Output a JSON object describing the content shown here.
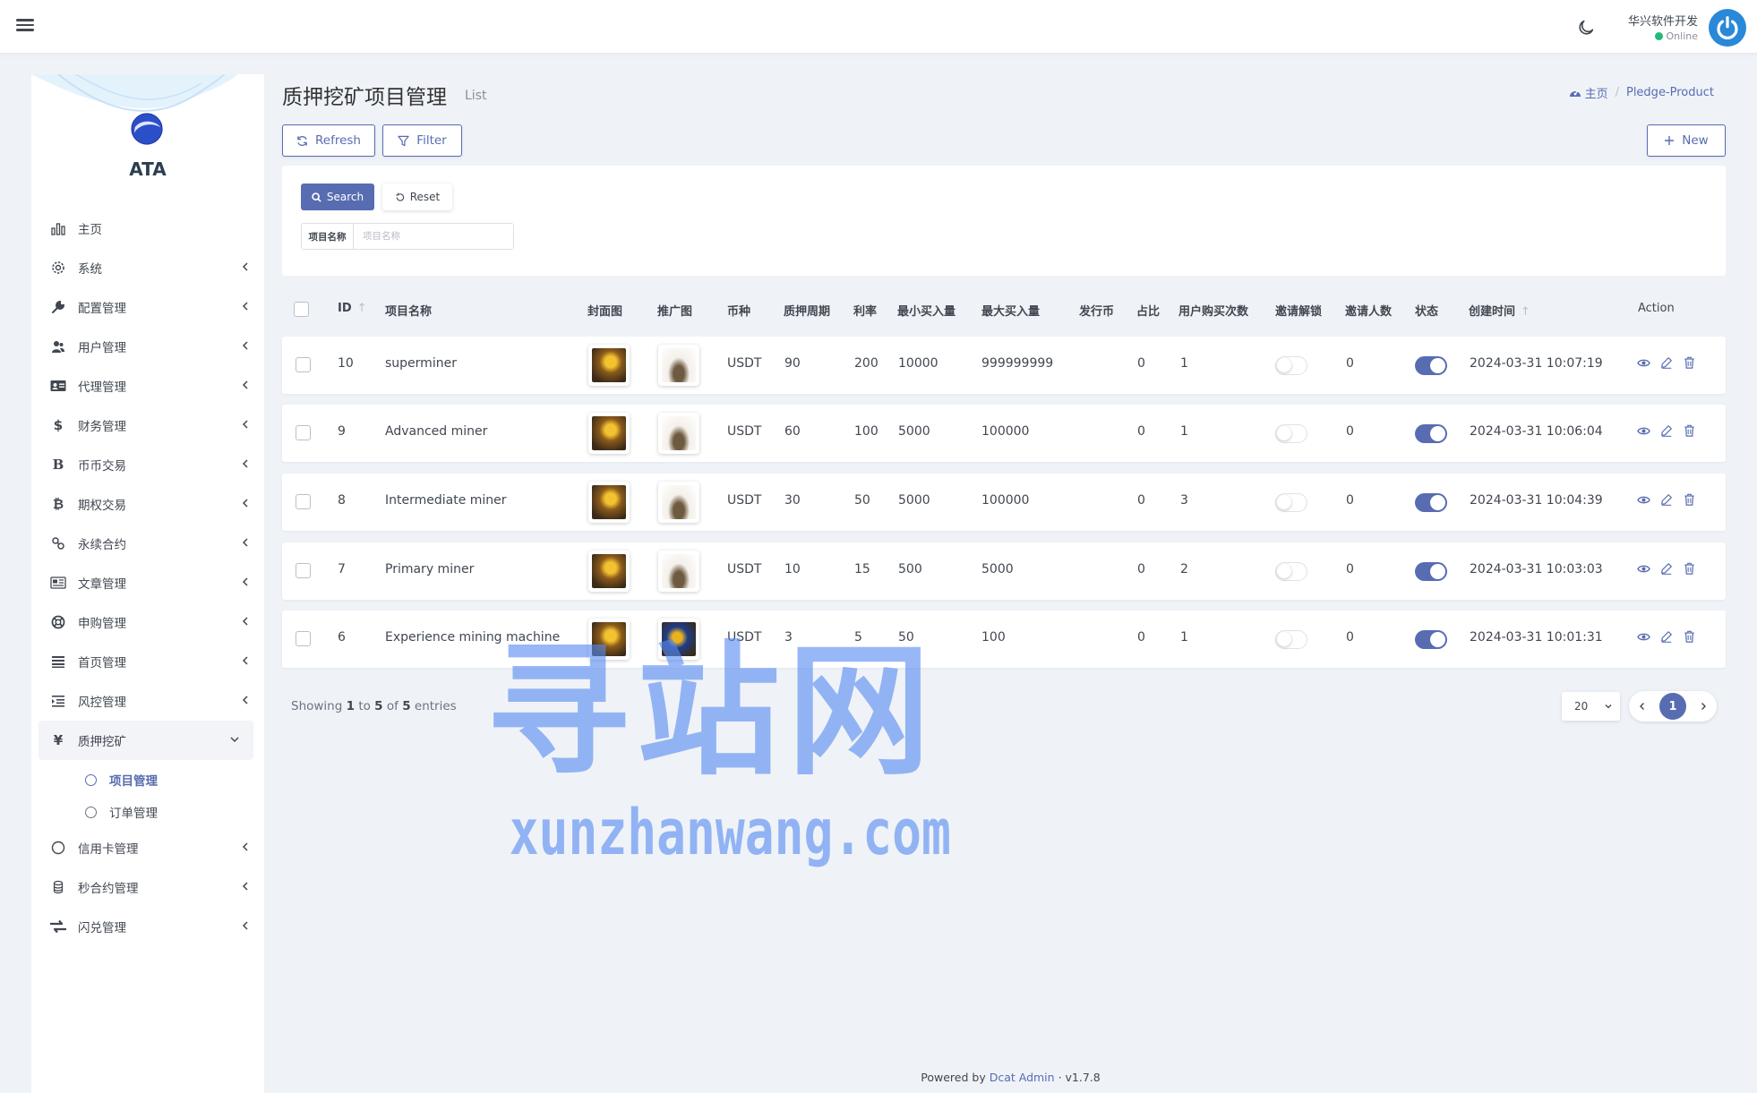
{
  "header": {
    "user_name": "华兴软件开发",
    "user_status": "Online"
  },
  "sidebar": {
    "brand": "ATA",
    "items": [
      {
        "label": "主页",
        "icon": "bar-chart-icon",
        "has_children": false
      },
      {
        "label": "系统",
        "icon": "gear-icon",
        "has_children": true
      },
      {
        "label": "配置管理",
        "icon": "wrench-icon",
        "has_children": true
      },
      {
        "label": "用户管理",
        "icon": "users-icon",
        "has_children": true
      },
      {
        "label": "代理管理",
        "icon": "id-card-icon",
        "has_children": true
      },
      {
        "label": "财务管理",
        "icon": "dollar-icon",
        "has_children": true
      },
      {
        "label": "币币交易",
        "icon": "bold-b-icon",
        "has_children": true
      },
      {
        "label": "期权交易",
        "icon": "bitcoin-icon",
        "has_children": true
      },
      {
        "label": "永续合约",
        "icon": "link-icon",
        "has_children": true
      },
      {
        "label": "文章管理",
        "icon": "newspaper-icon",
        "has_children": true
      },
      {
        "label": "申购管理",
        "icon": "lifebuoy-icon",
        "has_children": true
      },
      {
        "label": "首页管理",
        "icon": "list-icon",
        "has_children": true
      },
      {
        "label": "风控管理",
        "icon": "outdent-icon",
        "has_children": true
      },
      {
        "label": "质押挖矿",
        "icon": "yen-icon",
        "has_children": true,
        "expanded": true
      },
      {
        "label": "信用卡管理",
        "icon": "circle-icon",
        "has_children": true
      },
      {
        "label": "秒合约管理",
        "icon": "coins-icon",
        "has_children": true
      },
      {
        "label": "闪兑管理",
        "icon": "exchange-icon",
        "has_children": true
      }
    ],
    "submenu": [
      {
        "label": "项目管理",
        "active": true
      },
      {
        "label": "订单管理",
        "active": false
      }
    ]
  },
  "page": {
    "title": "质押挖矿项目管理",
    "subtitle": "List",
    "breadcrumb_home": "主页",
    "breadcrumb_current": "Pledge-Product"
  },
  "toolbar": {
    "refresh": "Refresh",
    "filter": "Filter",
    "new": "New"
  },
  "filter": {
    "search": "Search",
    "reset": "Reset",
    "field_label": "项目名称",
    "field_placeholder": "项目名称"
  },
  "table": {
    "columns": [
      "ID",
      "项目名称",
      "封面图",
      "推广图",
      "币种",
      "质押周期",
      "利率",
      "最小买入量",
      "最大买入量",
      "发行币",
      "占比",
      "用户购买次数",
      "邀请解锁",
      "邀请人数",
      "状态",
      "创建时间",
      "Action"
    ],
    "rows": [
      {
        "id": "10",
        "name": "superminer",
        "coin": "USDT",
        "period": "90",
        "rate": "200",
        "min": "10000",
        "max": "999999999",
        "issue": "",
        "ratio": "0",
        "buys": "1",
        "invite_unlock": false,
        "invites": "0",
        "status": true,
        "created": "2024-03-31 10:07:19"
      },
      {
        "id": "9",
        "name": "Advanced miner",
        "coin": "USDT",
        "period": "60",
        "rate": "100",
        "min": "5000",
        "max": "100000",
        "issue": "",
        "ratio": "0",
        "buys": "1",
        "invite_unlock": false,
        "invites": "0",
        "status": true,
        "created": "2024-03-31 10:06:04"
      },
      {
        "id": "8",
        "name": "Intermediate miner",
        "coin": "USDT",
        "period": "30",
        "rate": "50",
        "min": "5000",
        "max": "100000",
        "issue": "",
        "ratio": "0",
        "buys": "3",
        "invite_unlock": false,
        "invites": "0",
        "status": true,
        "created": "2024-03-31 10:04:39"
      },
      {
        "id": "7",
        "name": "Primary miner",
        "coin": "USDT",
        "period": "10",
        "rate": "15",
        "min": "500",
        "max": "5000",
        "issue": "",
        "ratio": "0",
        "buys": "2",
        "invite_unlock": false,
        "invites": "0",
        "status": true,
        "created": "2024-03-31 10:03:03"
      },
      {
        "id": "6",
        "name": "Experience mining machine",
        "coin": "USDT",
        "period": "3",
        "rate": "5",
        "min": "50",
        "max": "100",
        "issue": "",
        "ratio": "0",
        "buys": "1",
        "invite_unlock": false,
        "invites": "0",
        "status": true,
        "created": "2024-03-31 10:01:31"
      }
    ]
  },
  "pagination": {
    "showing_prefix": "Showing",
    "from": "1",
    "to_word": "to",
    "to": "5",
    "of_word": "of",
    "total": "5",
    "entries_word": "entries",
    "per_page": "20",
    "current_page": "1"
  },
  "footer": {
    "powered_by": "Powered by",
    "link": "Dcat Admin",
    "sep": "·",
    "version": "v1.7.8"
  },
  "watermark": {
    "cn": "寻站网",
    "en": "xunzhanwang.com"
  },
  "colors": {
    "accent": "#586cb1",
    "background": "#eff3f8",
    "online": "#21b978"
  }
}
